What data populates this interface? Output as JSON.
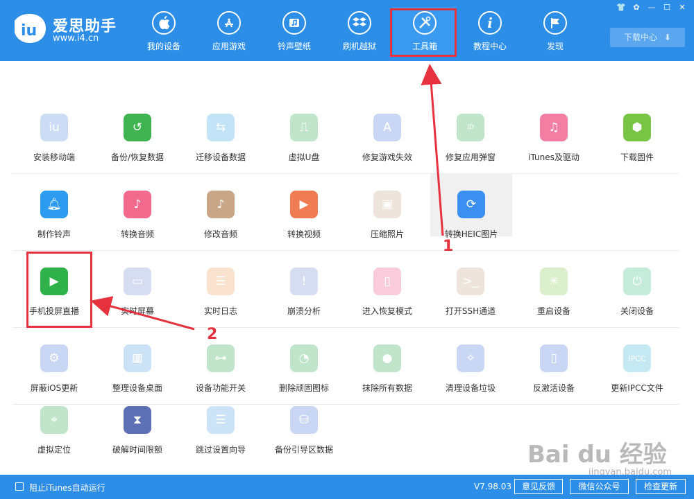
{
  "header": {
    "brand_name": "爱思助手",
    "brand_url": "www.i4.cn",
    "nav": [
      {
        "label": "我的设备",
        "icon": "apple-icon"
      },
      {
        "label": "应用游戏",
        "icon": "app-store-icon"
      },
      {
        "label": "铃声壁纸",
        "icon": "music-note-icon"
      },
      {
        "label": "刷机越狱",
        "icon": "dropbox-box-icon"
      },
      {
        "label": "工具箱",
        "icon": "tools-icon"
      },
      {
        "label": "教程中心",
        "icon": "info-icon"
      },
      {
        "label": "发现",
        "icon": "flag-icon"
      }
    ],
    "active_nav": "工具箱",
    "download_label": "下载中心",
    "window_controls": [
      "shirt-icon",
      "gear-icon",
      "minimize-icon",
      "maximize-icon",
      "close-icon"
    ]
  },
  "tools": {
    "row1": [
      {
        "label": "安装移动端",
        "icon": "i4-icon",
        "color": "#8fb2e8"
      },
      {
        "label": "备份/恢复数据",
        "icon": "clock-backup-icon",
        "color": "#3fb34f"
      },
      {
        "label": "迁移设备数据",
        "icon": "phones-transfer-icon",
        "color": "#9ed4f2"
      },
      {
        "label": "虚拟U盘",
        "icon": "usb-icon",
        "color": "#a8dcb4"
      },
      {
        "label": "修复游戏失效",
        "icon": "app-store-icon",
        "color": "#b5c8ef"
      },
      {
        "label": "修复应用弹窗",
        "icon": "apple-id-icon",
        "color": "#a8dcb4"
      },
      {
        "label": "iTunes及驱动",
        "icon": "itunes-icon",
        "color": "#f27fa3"
      },
      {
        "label": "下载固件",
        "icon": "cube-icon",
        "color": "#78c445"
      }
    ],
    "row2": [
      {
        "label": "制作铃声",
        "icon": "bell-icon",
        "color": "#2d9cf0"
      },
      {
        "label": "转换音频",
        "icon": "music-icon",
        "color": "#f26a8d"
      },
      {
        "label": "修改音频",
        "icon": "audio-edit-icon",
        "color": "#c8a686"
      },
      {
        "label": "转换视频",
        "icon": "play-icon",
        "color": "#f07c54"
      },
      {
        "label": "压缩照片",
        "icon": "photo-icon",
        "color": "#e8dccc"
      },
      {
        "label": "转换HEIC图片",
        "icon": "heic-icon",
        "color": "#3a8ff0"
      }
    ],
    "row3": [
      {
        "label": "手机投屏直播",
        "icon": "screen-cast-icon",
        "color": "#2fb24a"
      },
      {
        "label": "实时屏幕",
        "icon": "monitor-icon",
        "color": "#c6cdea"
      },
      {
        "label": "实时日志",
        "icon": "document-icon",
        "color": "#f6d7b6"
      },
      {
        "label": "崩溃分析",
        "icon": "crash-list-icon",
        "color": "#c6cdea"
      },
      {
        "label": "进入恢复模式",
        "icon": "recovery-phone-icon",
        "color": "#f5a9c0"
      },
      {
        "label": "打开SSH通道",
        "icon": "terminal-icon",
        "color": "#e8dccc"
      },
      {
        "label": "重启设备",
        "icon": "restart-icon",
        "color": "#cfe8b8"
      },
      {
        "label": "关闭设备",
        "icon": "power-icon",
        "color": "#a8e0c6"
      }
    ],
    "row4": [
      {
        "label": "屏蔽iOS更新",
        "icon": "gear-block-icon",
        "color": "#b5c8ef"
      },
      {
        "label": "整理设备桌面",
        "icon": "grid-icon",
        "color": "#b7d6f3"
      },
      {
        "label": "设备功能开关",
        "icon": "toggle-icon",
        "color": "#a8dcb4"
      },
      {
        "label": "删除顽固图标",
        "icon": "pie-icon",
        "color": "#a8dcb4"
      },
      {
        "label": "抹除所有数据",
        "icon": "apple-icon",
        "color": "#a8dcb4"
      },
      {
        "label": "清理设备垃圾",
        "icon": "broom-icon",
        "color": "#b5c8ef"
      },
      {
        "label": "反激活设备",
        "icon": "deactivate-phone-icon",
        "color": "#b5c8ef"
      },
      {
        "label": "更新IPCC文件",
        "icon": "ipcc-icon",
        "color": "#a8e0ec"
      }
    ],
    "row5": [
      {
        "label": "虚拟定位",
        "icon": "location-icon",
        "color": "#a8dcb4"
      },
      {
        "label": "破解时间限额",
        "icon": "hourglass-icon",
        "color": "#5d6fb5"
      },
      {
        "label": "跳过设置向导",
        "icon": "skip-wizard-icon",
        "color": "#b7d6f3"
      },
      {
        "label": "备份引导区数据",
        "icon": "disk-backup-icon",
        "color": "#b5c8ef"
      }
    ]
  },
  "annotations": {
    "one": "1",
    "two": "2"
  },
  "footer": {
    "checkbox_label": "阻止iTunes自动运行",
    "version": "V7.98.03",
    "feedback": "意见反馈",
    "wechat": "微信公众号",
    "update": "检查更新"
  },
  "watermark": {
    "main": "Bai du 经验",
    "sub": "jingyan.baidu.com"
  },
  "colors": {
    "header": "#2d8ee8",
    "annotation": "#e5323e"
  }
}
